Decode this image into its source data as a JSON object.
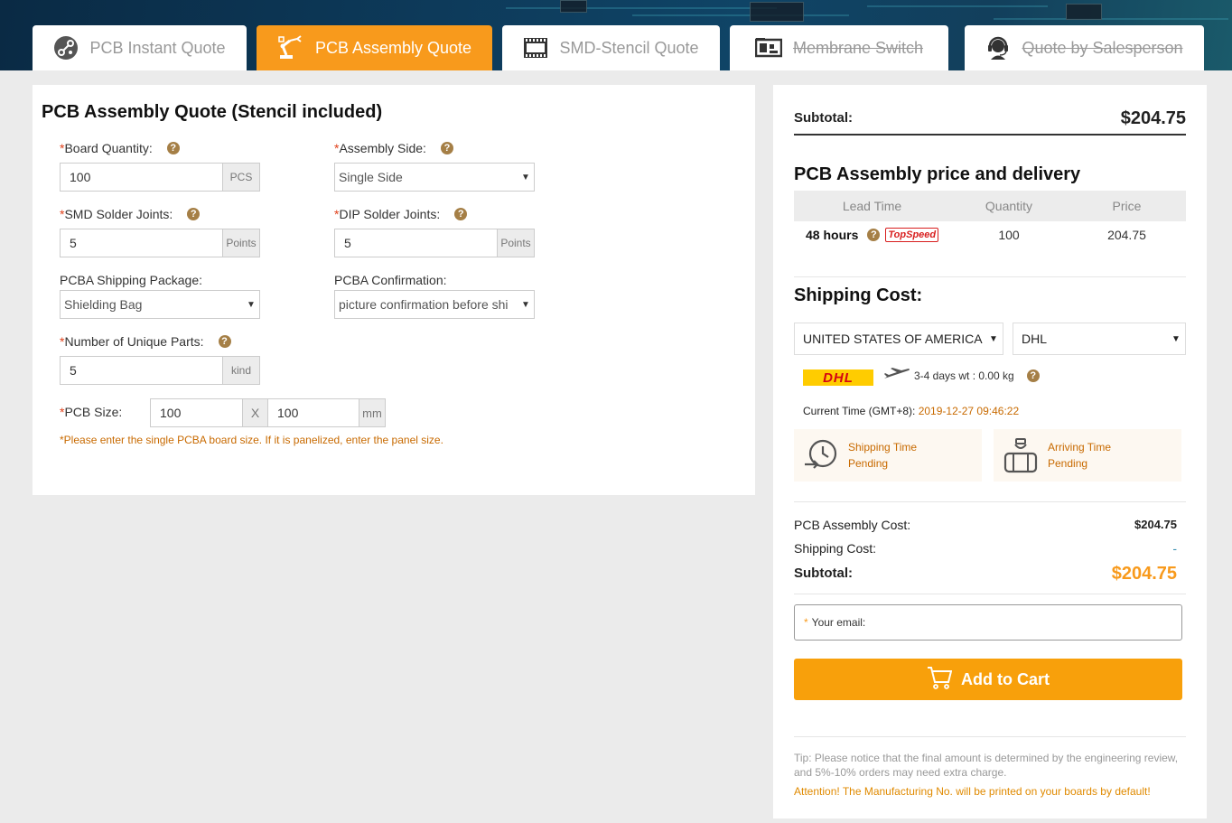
{
  "tabs": [
    {
      "label": "PCB Instant Quote"
    },
    {
      "label": "PCB Assembly Quote"
    },
    {
      "label": "SMD-Stencil Quote"
    },
    {
      "label": "Membrane Switch"
    },
    {
      "label": "Quote by Salesperson"
    }
  ],
  "form": {
    "title": "PCB Assembly Quote (Stencil included)",
    "board_quantity": {
      "label": "Board Quantity:",
      "value": "100",
      "unit": "PCS"
    },
    "assembly_side": {
      "label": "Assembly Side:",
      "value": "Single Side"
    },
    "smd_joints": {
      "label": "SMD Solder Joints:",
      "value": "5",
      "unit": "Points"
    },
    "dip_joints": {
      "label": "DIP Solder Joints:",
      "value": "5",
      "unit": "Points"
    },
    "shipping_package": {
      "label": "PCBA Shipping Package:",
      "value": "Shielding Bag"
    },
    "confirmation": {
      "label": "PCBA Confirmation:",
      "value": "picture confirmation before shi"
    },
    "unique_parts": {
      "label": "Number of Unique Parts:",
      "value": "5",
      "unit": "kind"
    },
    "pcb_size": {
      "label": "PCB Size:",
      "width": "100",
      "sep": "X",
      "height": "100",
      "unit": "mm"
    },
    "note": "*Please enter the single PCBA board size. If it is panelized, enter the panel size.",
    "required_mark": "*",
    "help_glyph": "?"
  },
  "summary": {
    "subtotal_label": "Subtotal:",
    "subtotal_value": "$204.75",
    "price_heading": "PCB Assembly price and delivery",
    "table_headers": [
      "Lead Time",
      "Quantity",
      "Price"
    ],
    "row": {
      "lead_time": "48 hours",
      "badge": "TopSpeed",
      "quantity": "100",
      "price": "204.75"
    },
    "shipping_heading": "Shipping Cost:",
    "country": "UNITED STATES OF AMERICA",
    "carrier": "DHL",
    "carrier_logo": "DHL",
    "ship_info": "3-4 days wt : 0.00 kg",
    "current_time_label": "Current Time (GMT+8):",
    "current_time": "2019-12-27 09:46:22",
    "shipping_time_label": "Shipping Time",
    "shipping_time_value": "Pending",
    "arriving_time_label": "Arriving Time",
    "arriving_time_value": "Pending",
    "assembly_cost_label": "PCB Assembly Cost:",
    "assembly_cost_value": "$204.75",
    "shipping_cost_label": "Shipping Cost:",
    "shipping_cost_value": "-",
    "total_label": "Subtotal:",
    "total_value": "$204.75",
    "email_star": "*",
    "email_placeholder": "Your email:",
    "cart_label": "Add to Cart",
    "tip": "Tip: Please notice that the final amount is determined by the engineering review, and 5%-10% orders may need extra charge.",
    "attention": "Attention! The Manufacturing No. will be printed on your boards by default!"
  },
  "colors": {
    "accent": "#f89a1c",
    "brown_help": "#a57f46",
    "note_orange": "#c86a00"
  }
}
